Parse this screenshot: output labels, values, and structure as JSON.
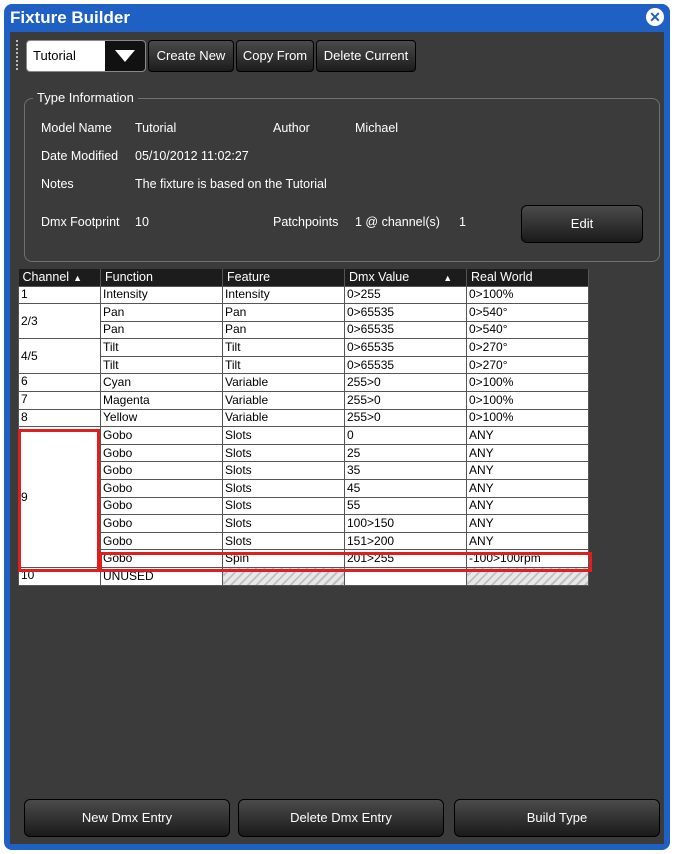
{
  "window": {
    "title": "Fixture Builder"
  },
  "toolbar": {
    "fixture_select": "Tutorial",
    "create_new": "Create New",
    "copy_from": "Copy From",
    "delete_current": "Delete Current"
  },
  "type_info": {
    "legend": "Type Information",
    "model_name_label": "Model Name",
    "model_name": "Tutorial",
    "author_label": "Author",
    "author": "Michael",
    "date_modified_label": "Date Modified",
    "date_modified": "05/10/2012 11:02:27",
    "notes_label": "Notes",
    "notes": "The fixture is based on the Tutorial",
    "dmx_footprint_label": "Dmx Footprint",
    "dmx_footprint": "10",
    "patchpoints_label": "Patchpoints",
    "patchpoints": "1 @ channel(s)",
    "patchpoints_channel": "1",
    "edit": "Edit"
  },
  "grid": {
    "columns": [
      "Channel",
      "Function",
      "Feature",
      "Dmx Value",
      "Real World"
    ],
    "groups": [
      {
        "channel": "1",
        "rows": [
          [
            "Intensity",
            "Intensity",
            "0>255",
            "0>100%"
          ]
        ]
      },
      {
        "channel": "2/3",
        "rows": [
          [
            "Pan",
            "Pan",
            "0>65535",
            "0>540°"
          ],
          [
            "Pan",
            "Pan",
            "0>65535",
            "0>540°"
          ]
        ]
      },
      {
        "channel": "4/5",
        "rows": [
          [
            "Tilt",
            "Tilt",
            "0>65535",
            "0>270°"
          ],
          [
            "Tilt",
            "Tilt",
            "0>65535",
            "0>270°"
          ]
        ]
      },
      {
        "channel": "6",
        "rows": [
          [
            "Cyan",
            "Variable",
            "255>0",
            "0>100%"
          ]
        ]
      },
      {
        "channel": "7",
        "rows": [
          [
            "Magenta",
            "Variable",
            "255>0",
            "0>100%"
          ]
        ]
      },
      {
        "channel": "8",
        "rows": [
          [
            "Yellow",
            "Variable",
            "255>0",
            "0>100%"
          ]
        ]
      },
      {
        "channel": "9",
        "rows": [
          [
            "Gobo",
            "Slots",
            "0",
            "ANY"
          ],
          [
            "Gobo",
            "Slots",
            "25",
            "ANY"
          ],
          [
            "Gobo",
            "Slots",
            "35",
            "ANY"
          ],
          [
            "Gobo",
            "Slots",
            "45",
            "ANY"
          ],
          [
            "Gobo",
            "Slots",
            "55",
            "ANY"
          ],
          [
            "Gobo",
            "Slots",
            "100>150",
            "ANY"
          ],
          [
            "Gobo",
            "Slots",
            "151>200",
            "ANY"
          ],
          [
            "Gobo",
            "Spin",
            "201>255",
            "-100>100rpm"
          ]
        ]
      },
      {
        "channel": "10",
        "rows": [
          [
            "UNUSED",
            "",
            "",
            ""
          ]
        ]
      }
    ]
  },
  "bottom": {
    "new_entry": "New Dmx Entry",
    "delete_entry": "Delete Dmx Entry",
    "build_type": "Build Type"
  },
  "colors": {
    "title_bar": "#1f60c4",
    "panel": "#3b3b3b",
    "highlight": "#e01e1e"
  }
}
